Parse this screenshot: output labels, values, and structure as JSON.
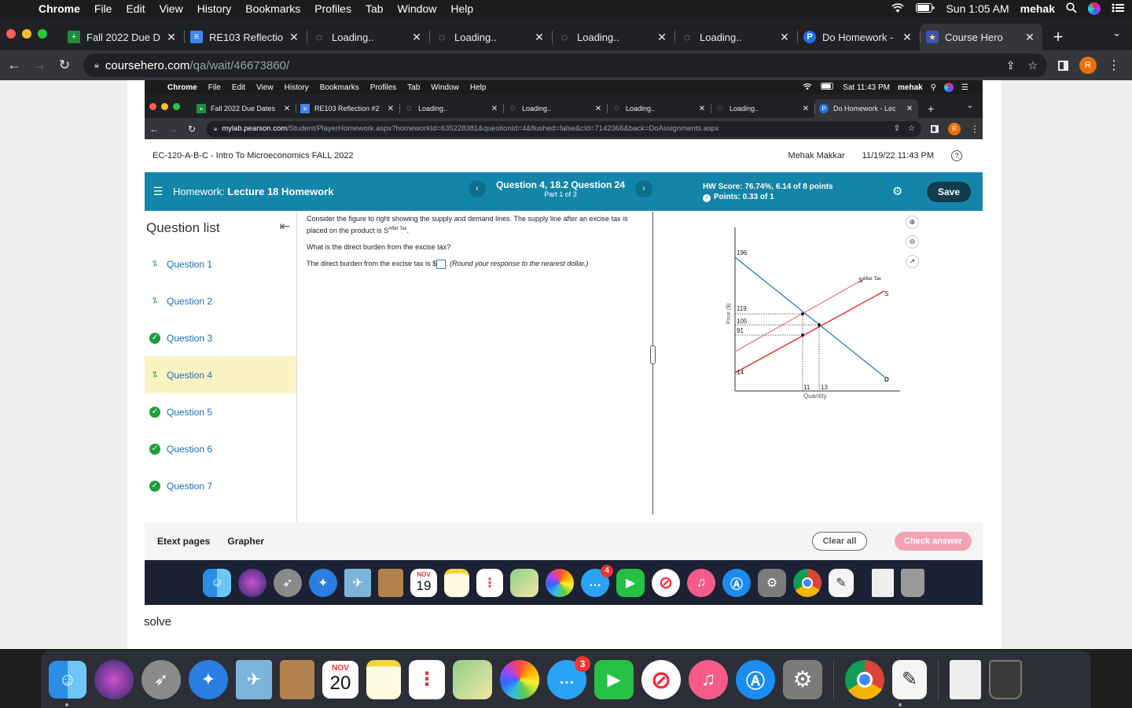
{
  "menubar": {
    "app": "Chrome",
    "items": [
      "File",
      "Edit",
      "View",
      "History",
      "Bookmarks",
      "Profiles",
      "Tab",
      "Window",
      "Help"
    ],
    "time": "Sun 1:05 AM",
    "user": "mehak"
  },
  "tabs": [
    {
      "title": "Fall 2022 Due D",
      "color": "#1e8e3e",
      "icon": "+"
    },
    {
      "title": "RE103 Reflectio",
      "color": "#4285f4",
      "icon": "≡"
    },
    {
      "title": "Loading..",
      "color": "#9aa0a6",
      "icon": "◌"
    },
    {
      "title": "Loading..",
      "color": "#9aa0a6",
      "icon": "◌"
    },
    {
      "title": "Loading..",
      "color": "#9aa0a6",
      "icon": "◌"
    },
    {
      "title": "Loading..",
      "color": "#9aa0a6",
      "icon": "◌"
    },
    {
      "title": "Do Homework -",
      "color": "#1a73e8",
      "icon": "P"
    },
    {
      "title": "Course Hero",
      "color": "#3f51b5",
      "icon": "★"
    }
  ],
  "address": {
    "host": "coursehero.com",
    "path": "/qa/wait/46673860/"
  },
  "shot": {
    "menubar": {
      "app": "Chrome",
      "items": [
        "File",
        "Edit",
        "View",
        "History",
        "Bookmarks",
        "Profiles",
        "Tab",
        "Window",
        "Help"
      ],
      "time": "Sat 11:43 PM",
      "user": "mehak"
    },
    "tabs": [
      {
        "title": "Fall 2022 Due Dates",
        "icon": "+",
        "color": "#1e8e3e"
      },
      {
        "title": "RE103 Reflection #2",
        "icon": "≡",
        "color": "#4285f4"
      },
      {
        "title": "Loading..",
        "icon": "◌",
        "color": "#9aa0a6"
      },
      {
        "title": "Loading..",
        "icon": "◌",
        "color": "#9aa0a6"
      },
      {
        "title": "Loading..",
        "icon": "◌",
        "color": "#9aa0a6"
      },
      {
        "title": "Loading..",
        "icon": "◌",
        "color": "#9aa0a6"
      },
      {
        "title": "Do Homework - Lec",
        "icon": "P",
        "color": "#1a73e8"
      }
    ],
    "address": {
      "host": "mylab.pearson.com",
      "path": "/Student/PlayerHomework.aspx?homeworkId=635228381&questionId=4&flushed=false&cId=7142366&back=DoAssignments.aspx"
    },
    "course": {
      "name": "EC-120-A-B-C - Intro To Microeconomics FALL 2022",
      "user": "Mehak Makkar",
      "datetime": "11/19/22 11:43 PM"
    },
    "hw": {
      "label": "Homework:",
      "name": "Lecture 18 Homework",
      "question": "Question 4, 18.2 Question 24",
      "part": "Part 1 of 3",
      "score": "HW Score: 76.74%, 6.14 of 8 points",
      "points": "Points: 0.33 of 1",
      "save": "Save"
    },
    "qlist": {
      "header": "Question list",
      "items": [
        {
          "label": "Question 1",
          "status": "partial"
        },
        {
          "label": "Question 2",
          "status": "partial"
        },
        {
          "label": "Question 3",
          "status": "correct"
        },
        {
          "label": "Question 4",
          "status": "partial"
        },
        {
          "label": "Question 5",
          "status": "correct"
        },
        {
          "label": "Question 6",
          "status": "correct"
        },
        {
          "label": "Question 7",
          "status": "correct"
        }
      ]
    },
    "question": {
      "p1a": "Consider the figure to right showing the supply and demand lines. The supply line after an excise tax is placed on the product is S",
      "p1sup": "After Tax",
      "p1b": ".",
      "p2": "What is the direct burden from the excise tax?",
      "p3a": "The direct burden from the excise tax is $",
      "p3b": ".",
      "p3note": "(Round your response to the nearest dollar.)"
    },
    "graph": {
      "ylabel": "Price ($)",
      "xlabel": "Quantity",
      "y_ticks": [
        "196",
        "119",
        "105",
        "91",
        "14"
      ],
      "x_ticks": [
        "11",
        "13"
      ],
      "label_s_after": "S",
      "label_s_after_sup": "After Tax",
      "label_s": "S",
      "label_d": "D"
    },
    "footer": {
      "etext": "Etext pages",
      "grapher": "Grapher",
      "clear": "Clear all",
      "check": "Check answer"
    },
    "calendar": {
      "month": "NOV",
      "day": "19"
    },
    "messages_badge": "4"
  },
  "below": {
    "text": "solve"
  },
  "dock": {
    "calendar": {
      "month": "NOV",
      "day": "20"
    },
    "messages_badge": "3"
  }
}
